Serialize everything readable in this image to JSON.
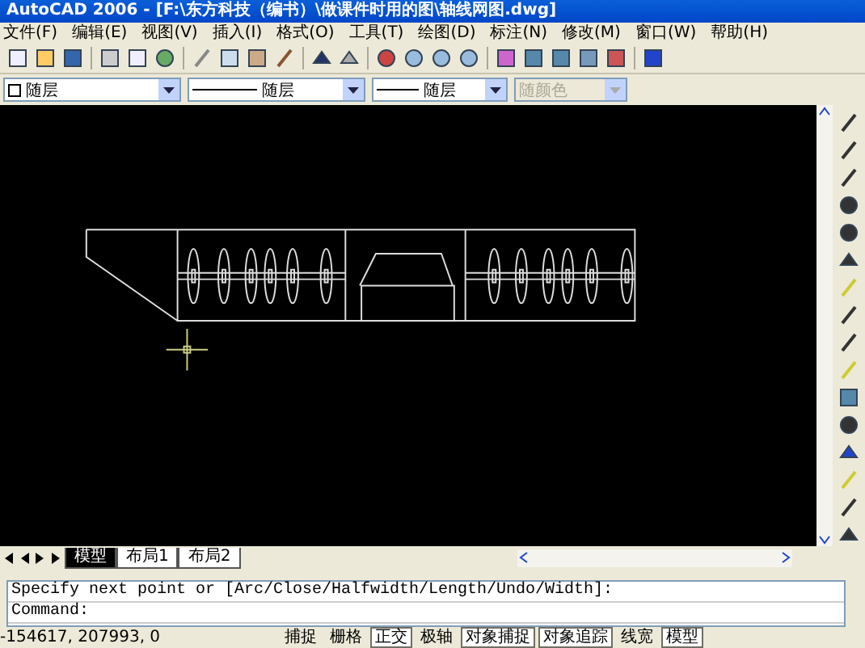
{
  "window": {
    "title": "AutoCAD 2006 - [F:\\东方科技（编书）\\做课件时用的图\\轴线网图.dwg]"
  },
  "menu": [
    "文件(F)",
    "编辑(E)",
    "视图(V)",
    "插入(I)",
    "格式(O)",
    "工具(T)",
    "绘图(D)",
    "标注(N)",
    "修改(M)",
    "窗口(W)",
    "帮助(H)"
  ],
  "properties": [
    {
      "kind": "layer",
      "value": "随层",
      "disabled": false
    },
    {
      "kind": "linetype",
      "value": "随层",
      "disabled": false
    },
    {
      "kind": "lineweight",
      "value": "随层",
      "disabled": false
    },
    {
      "kind": "color",
      "value": "随颜色",
      "disabled": true
    }
  ],
  "layout_tabs": [
    {
      "label": "模型",
      "selected": true
    },
    {
      "label": "布局1",
      "selected": false
    },
    {
      "label": "布局2",
      "selected": false
    }
  ],
  "command_lines": [
    "Specify next point or [Arc/Close/Halfwidth/Length/Undo/Width]:",
    "Command:"
  ],
  "status_bar": {
    "coordinates": "-154617, 207993, 0",
    "toggles": [
      {
        "label": "捕捉",
        "pressed": false
      },
      {
        "label": "栅格",
        "pressed": false
      },
      {
        "label": "正交",
        "pressed": true
      },
      {
        "label": "极轴",
        "pressed": false
      },
      {
        "label": "对象捕捉",
        "pressed": true
      },
      {
        "label": "对象追踪",
        "pressed": true
      },
      {
        "label": "线宽",
        "pressed": false
      },
      {
        "label": "模型",
        "pressed": true
      }
    ]
  }
}
